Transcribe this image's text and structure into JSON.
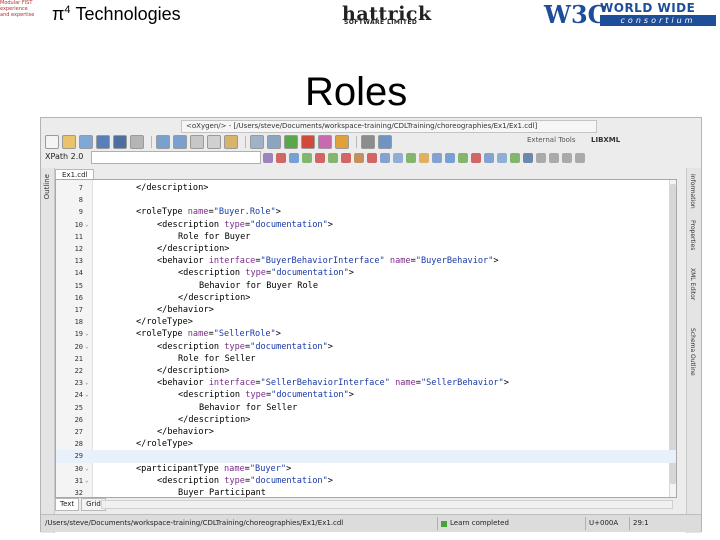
{
  "header": {
    "tiny_logo": [
      "Modular FIST",
      "experience",
      "and expertise"
    ],
    "pi_symbol": "π",
    "pi_sup": "4",
    "pi_text": " Technologies",
    "hattrick_name": "hattrick",
    "hattrick_sub": "SOFTWARE LIMITED",
    "w3c_mark": "W3C",
    "w3c_top": "WORLD WIDE WEB",
    "w3c_bar": "consortium",
    "title": "Roles"
  },
  "window": {
    "path": "<oXygen/> - [/Users/steve/Documents/workspace-training/CDLTraining/choreographies/Ex1/Ex1.cdl]",
    "external_tools": "External Tools",
    "libxml": "LIBXML",
    "xpath_label": "XPath 2.0"
  },
  "left_rail": {
    "outline": "Outline"
  },
  "right_rail": [
    "Information",
    "Properties",
    "XML Editor",
    "Schema Outline"
  ],
  "editor": {
    "tab_label": "Ex1.cdl",
    "lines": [
      {
        "n": "7",
        "indent": 1,
        "tokens": [
          {
            "t": "t",
            "v": "</description>"
          }
        ]
      },
      {
        "n": "8",
        "indent": 0,
        "tokens": []
      },
      {
        "n": "9",
        "indent": 1,
        "tokens": [
          {
            "t": "t",
            "v": "<roleType "
          },
          {
            "t": "an",
            "v": "name"
          },
          {
            "t": "t",
            "v": "="
          },
          {
            "t": "av",
            "v": "\"Buyer.Role\""
          },
          {
            "t": "t",
            "v": ">"
          }
        ]
      },
      {
        "n": "10",
        "indent": 2,
        "fold": "⌄",
        "tokens": [
          {
            "t": "t",
            "v": "<description "
          },
          {
            "t": "an",
            "v": "type"
          },
          {
            "t": "t",
            "v": "="
          },
          {
            "t": "av",
            "v": "\"documentation\""
          },
          {
            "t": "t",
            "v": ">"
          }
        ]
      },
      {
        "n": "11",
        "indent": 3,
        "tokens": [
          {
            "t": "t",
            "v": "Role for Buyer"
          }
        ]
      },
      {
        "n": "12",
        "indent": 2,
        "tokens": [
          {
            "t": "t",
            "v": "</description>"
          }
        ]
      },
      {
        "n": "13",
        "indent": 2,
        "tokens": [
          {
            "t": "t",
            "v": "<behavior "
          },
          {
            "t": "an",
            "v": "interface"
          },
          {
            "t": "t",
            "v": "="
          },
          {
            "t": "av",
            "v": "\"BuyerBehaviorInterface\""
          },
          {
            "t": "t",
            "v": " "
          },
          {
            "t": "an",
            "v": "name"
          },
          {
            "t": "t",
            "v": "="
          },
          {
            "t": "av",
            "v": "\"BuyerBehavior\""
          },
          {
            "t": "t",
            "v": ">"
          }
        ]
      },
      {
        "n": "14",
        "indent": 3,
        "tokens": [
          {
            "t": "t",
            "v": "<description "
          },
          {
            "t": "an",
            "v": "type"
          },
          {
            "t": "t",
            "v": "="
          },
          {
            "t": "av",
            "v": "\"documentation\""
          },
          {
            "t": "t",
            "v": ">"
          }
        ]
      },
      {
        "n": "15",
        "indent": 4,
        "tokens": [
          {
            "t": "t",
            "v": "Behavior for Buyer Role"
          }
        ]
      },
      {
        "n": "16",
        "indent": 3,
        "tokens": [
          {
            "t": "t",
            "v": "</description>"
          }
        ]
      },
      {
        "n": "17",
        "indent": 2,
        "tokens": [
          {
            "t": "t",
            "v": "</behavior>"
          }
        ]
      },
      {
        "n": "18",
        "indent": 1,
        "tokens": [
          {
            "t": "t",
            "v": "</roleType>"
          }
        ]
      },
      {
        "n": "19",
        "indent": 1,
        "fold": "⌄",
        "tokens": [
          {
            "t": "t",
            "v": "<roleType "
          },
          {
            "t": "an",
            "v": "name"
          },
          {
            "t": "t",
            "v": "="
          },
          {
            "t": "av",
            "v": "\"SellerRole\""
          },
          {
            "t": "t",
            "v": ">"
          }
        ]
      },
      {
        "n": "20",
        "indent": 2,
        "fold": "⌄",
        "tokens": [
          {
            "t": "t",
            "v": "<description "
          },
          {
            "t": "an",
            "v": "type"
          },
          {
            "t": "t",
            "v": "="
          },
          {
            "t": "av",
            "v": "\"documentation\""
          },
          {
            "t": "t",
            "v": ">"
          }
        ]
      },
      {
        "n": "21",
        "indent": 3,
        "tokens": [
          {
            "t": "t",
            "v": "Role for Seller"
          }
        ]
      },
      {
        "n": "22",
        "indent": 2,
        "tokens": [
          {
            "t": "t",
            "v": "</description>"
          }
        ]
      },
      {
        "n": "23",
        "indent": 2,
        "fold": "⌄",
        "tokens": [
          {
            "t": "t",
            "v": "<behavior "
          },
          {
            "t": "an",
            "v": "interface"
          },
          {
            "t": "t",
            "v": "="
          },
          {
            "t": "av",
            "v": "\"SellerBehaviorInterface\""
          },
          {
            "t": "t",
            "v": " "
          },
          {
            "t": "an",
            "v": "name"
          },
          {
            "t": "t",
            "v": "="
          },
          {
            "t": "av",
            "v": "\"SellerBehavior\""
          },
          {
            "t": "t",
            "v": ">"
          }
        ]
      },
      {
        "n": "24",
        "indent": 3,
        "fold": "⌄",
        "tokens": [
          {
            "t": "t",
            "v": "<description "
          },
          {
            "t": "an",
            "v": "type"
          },
          {
            "t": "t",
            "v": "="
          },
          {
            "t": "av",
            "v": "\"documentation\""
          },
          {
            "t": "t",
            "v": ">"
          }
        ]
      },
      {
        "n": "25",
        "indent": 4,
        "tokens": [
          {
            "t": "t",
            "v": "Behavior for Seller"
          }
        ]
      },
      {
        "n": "26",
        "indent": 3,
        "tokens": [
          {
            "t": "t",
            "v": "</description>"
          }
        ]
      },
      {
        "n": "27",
        "indent": 2,
        "tokens": [
          {
            "t": "t",
            "v": "</behavior>"
          }
        ]
      },
      {
        "n": "28",
        "indent": 1,
        "tokens": [
          {
            "t": "t",
            "v": "</roleType>"
          }
        ]
      },
      {
        "n": "29",
        "indent": 0,
        "hl": true,
        "tokens": []
      },
      {
        "n": "30",
        "indent": 1,
        "fold": "⌄",
        "tokens": [
          {
            "t": "t",
            "v": "<participantType "
          },
          {
            "t": "an",
            "v": "name"
          },
          {
            "t": "t",
            "v": "="
          },
          {
            "t": "av",
            "v": "\"Buyer\""
          },
          {
            "t": "t",
            "v": ">"
          }
        ]
      },
      {
        "n": "31",
        "indent": 2,
        "fold": "⌄",
        "tokens": [
          {
            "t": "t",
            "v": "<description "
          },
          {
            "t": "an",
            "v": "type"
          },
          {
            "t": "t",
            "v": "="
          },
          {
            "t": "av",
            "v": "\"documentation\""
          },
          {
            "t": "t",
            "v": ">"
          }
        ]
      },
      {
        "n": "32",
        "indent": 3,
        "tokens": [
          {
            "t": "t",
            "v": "Buyer Participant"
          }
        ]
      }
    ]
  },
  "bottom_tabs": [
    {
      "label": "Text",
      "active": true
    },
    {
      "label": "Grid",
      "active": false
    }
  ],
  "status": {
    "path": "/Users/steve/Documents/workspace-training/CDLTraining/choreographies/Ex1/Ex1.cdl",
    "message": "Learn completed",
    "char_code": "U+000A",
    "position": "29:1"
  },
  "icons": [
    "new-file-icon",
    "open-file-icon",
    "open-url-icon",
    "save-icon",
    "save-all-icon",
    "print-icon",
    "undo-icon",
    "redo-icon",
    "cut-icon",
    "copy-icon",
    "paste-icon",
    "find-icon",
    "find-in-files-icon",
    "validate-icon",
    "check-well-formed-icon",
    "transform-icon",
    "debug-icon",
    "configure-icon",
    "external-tool-icon"
  ],
  "colors": {
    "tag": "#000000",
    "attr_name": "#7b2d8b",
    "attr_value": "#1a3aa8",
    "highlight_line": "#e8f0fb",
    "w3c_blue": "#1e4e9a"
  }
}
